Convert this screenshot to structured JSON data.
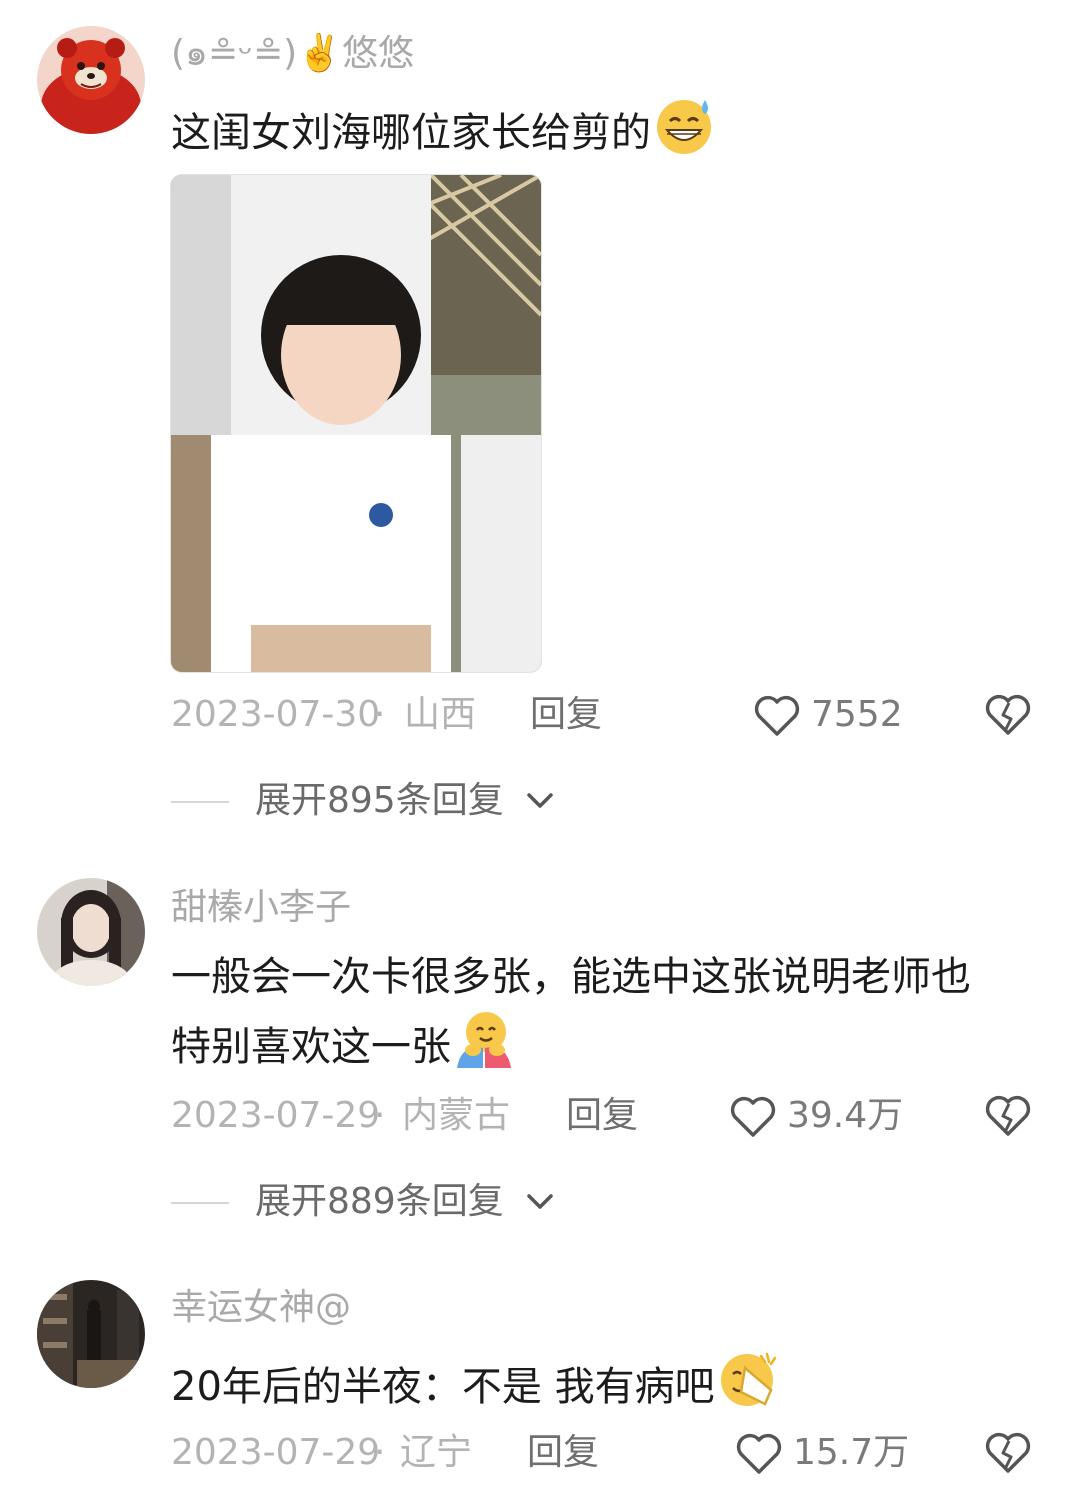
{
  "comments": [
    {
      "username": "(๑≗ᵕ≗)✌️悠悠",
      "text": "这闺女刘海哪位家长给剪的",
      "emoji": "grinning-sweat-emoji",
      "date": "2023-07-30",
      "separator": "·",
      "region": "山西",
      "reply_label": "回复",
      "likes": "7552",
      "expand_label": "展开895条回复"
    },
    {
      "username": "甜榛小李子",
      "text": "一般会一次卡很多张，能选中这张说明老师也特别喜欢这一张",
      "emoji": "hugging-face-emoji",
      "date": "2023-07-29",
      "separator": "·",
      "region": "内蒙古",
      "reply_label": "回复",
      "likes": "39.4万",
      "expand_label": "展开889条回复"
    },
    {
      "username": "幸运女神@",
      "text": "20年后的半夜：不是 我有病吧",
      "emoji": "face-palm-emoji",
      "date": "2023-07-29",
      "separator": "·",
      "region": "辽宁",
      "reply_label": "回复",
      "likes": "15.7万"
    }
  ],
  "colors": {
    "username": "#a9a9a9",
    "meta": "#b3b3b3",
    "reply": "#6f6f6f",
    "text": "#1c1c1c"
  }
}
